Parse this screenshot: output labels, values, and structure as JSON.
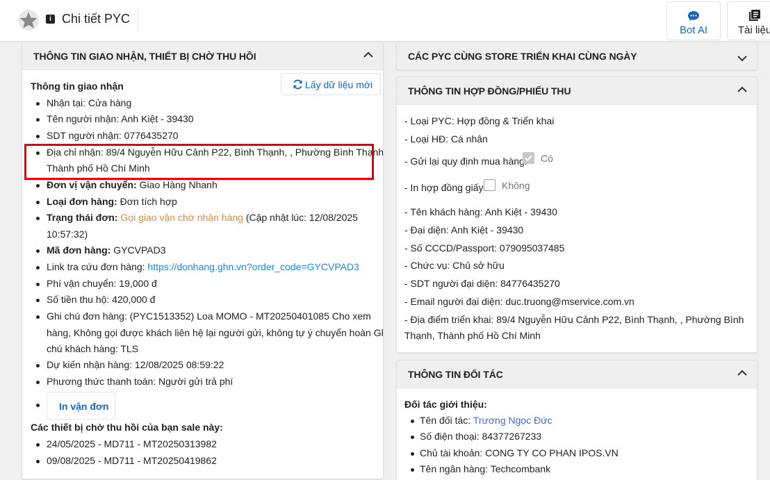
{
  "header": {
    "title": "Chi tiết PYC",
    "bot_label": "Bot AI",
    "docs_label": "Tài liệu"
  },
  "left_panel": {
    "title": "THÔNG TIN GIAO NHẬN, THIẾT BỊ CHỜ THU HỒI",
    "section_title": "Thông tin giao nhận",
    "refresh_label": "Lấy dữ liệu mới",
    "items": {
      "nhan_tai": "Nhận tại: Cửa hàng",
      "ten_nguoi_nhan": "Tên người nhận: Anh Kiệt - 39430",
      "sdt": "SDT người nhận: 0776435270",
      "dia_chi_1": "Địa chỉ nhận: 89/4 Nguyễn Hữu Cảnh P22, Bình Thạnh, , Phường Bình Thạnh,",
      "dia_chi_2": "Thành phố Hồ Chí Minh",
      "dvvc_label": "Đơn vị vận chuyển:",
      "dvvc_value": " Giao Hàng Nhanh",
      "loai_label": "Loại đơn hàng:",
      "loai_value": " Đơn tích hợp",
      "trang_thai_label": "Trạng thái đơn:",
      "trang_thai_value": "Gọi giao vận chờ nhận hàng",
      "trang_thai_note": " (Cập nhật lúc: 12/08/2025",
      "trang_thai_time": "10:57:32)",
      "ma_label": "Mã đơn hàng:",
      "ma_value": " GYCVPAD3",
      "link_label": "Link tra cứu đơn hàng: ",
      "link_value": "https://donhang.ghn.vn?order_code=GYCVPAD3",
      "phi": "Phí vận chuyển: 19,000 đ",
      "thu_ho": "Số tiền thu hộ: 420,000 đ",
      "ghi_chu_1": "Ghi chú đơn hàng: (PYC1513352) Loa MOMO - MT20250401085 Cho xem",
      "ghi_chu_2": "hàng, Không gọi được khách liên hệ lại người gửi, không tự ý chuyển hoàn Ghi",
      "ghi_chu_3": "chú khách hàng: TLS",
      "du_kien": "Dự kiến nhận hàng: 12/08/2025 08:59:22",
      "thanh_toan": "Phương thức thanh toán: Người gửi trả phí"
    },
    "print_label": "In vận đơn",
    "devices_title": "Các thiết bị chờ thu hồi của bạn sale này:",
    "devices": [
      "24/05/2025 - MD711 - MT20250313982",
      "09/08/2025 - MD711 - MT20250419862"
    ]
  },
  "right_panel_1": {
    "title": "CÁC PYC CÙNG STORE TRIỂN KHAI CÙNG NGÀY"
  },
  "right_panel_2": {
    "title": "THÔNG TIN HỢP ĐỒNG/PHIẾU THU",
    "loai_pyc": "- Loại PYC: Hợp đồng & Triển khai",
    "loai_hd": "- Loại HĐ: Cá nhân",
    "gui_lai": "- Gửi lại quy định mua hàng:",
    "gui_lai_value": "Có",
    "in_hd": "- In hợp đồng giấy:",
    "in_hd_value": "Không",
    "ten_kh": "- Tên khách hàng: Anh Kiệt - 39430",
    "dai_dien": "- Đại diện: Anh Kiệt - 39430",
    "cccd": "- Số CCCD/Passport: 079095037485",
    "chuc_vu": "- Chức vụ: Chủ sở hữu",
    "sdt_dd": "- SDT người đại diện: 84776435270",
    "email": "- Email người đại diện: duc.truong@mservice.com.vn",
    "dia_diem_1": "- Địa điểm triển khai: 89/4 Nguyễn Hữu Cảnh P22, Bình Thạnh, , Phường Bình",
    "dia_diem_2": "Thạnh, Thành phố Hồ Chí Minh"
  },
  "right_panel_3": {
    "title": "THÔNG TIN ĐỐI TÁC",
    "section_title": "Đối tác giới thiệu:",
    "ten_label": "Tên đối tác: ",
    "ten_value": "Trương Ngọc Đức",
    "sdt": "Số điện thoại: 84377267233",
    "chu_tk": "Chủ tài khoản: CONG TY CO PHAN IPOS.VN",
    "ngan_hang": "Tên ngân hàng: Techcombank"
  },
  "colors": {
    "link": "#1e88e5",
    "status": "#e3893b",
    "highlight": "#e8000b",
    "primary": "#1565c0"
  }
}
